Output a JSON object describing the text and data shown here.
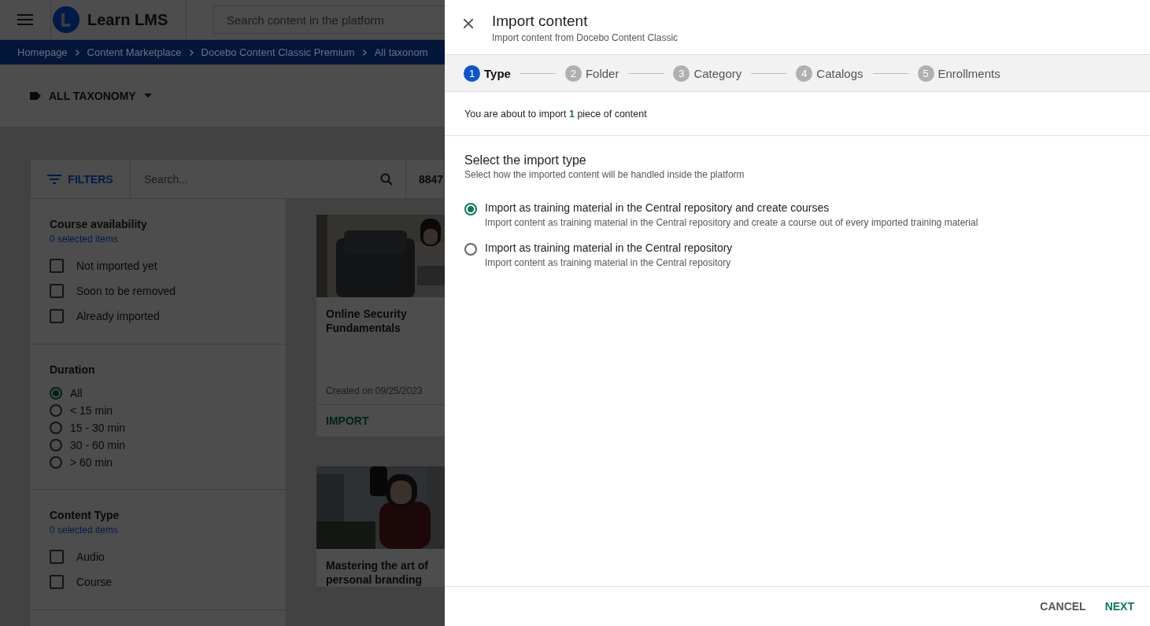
{
  "header": {
    "logo_text": "Learn LMS",
    "search_placeholder": "Search content in the platform"
  },
  "breadcrumbs": [
    "Homepage",
    "Content Marketplace",
    "Docebo Content Classic Premium",
    "All taxonom"
  ],
  "taxonomy_menu": {
    "label": "ALL TAXONOMY"
  },
  "toolbar": {
    "filters_label": "FILTERS",
    "search_placeholder": "Search...",
    "count": "8847"
  },
  "filter_groups": [
    {
      "title": "Course availability",
      "subtitle": "0 selected items",
      "kind": "checkbox",
      "options": [
        {
          "label": "Not imported yet",
          "checked": false
        },
        {
          "label": "Soon to be removed",
          "checked": false
        },
        {
          "label": "Already imported",
          "checked": false
        }
      ]
    },
    {
      "title": "Duration",
      "kind": "radio",
      "options": [
        {
          "label": "All",
          "selected": true
        },
        {
          "label": "< 15 min",
          "selected": false
        },
        {
          "label": "15 - 30 min",
          "selected": false
        },
        {
          "label": "30 - 60 min",
          "selected": false
        },
        {
          "label": "> 60 min",
          "selected": false
        }
      ]
    },
    {
      "title": "Content Type",
      "subtitle": "0 selected items",
      "kind": "checkbox",
      "options": [
        {
          "label": "Audio",
          "checked": false
        },
        {
          "label": "Course",
          "checked": false
        }
      ]
    }
  ],
  "cards": [
    {
      "title": "Online Security Fundamentals",
      "date": "Created on 09/25/2023",
      "action": "IMPORT"
    },
    {
      "title": "Mastering the art of personal branding"
    }
  ],
  "dialog": {
    "title": "Import content",
    "subtitle": "Import content from Docebo Content Classic",
    "steps": [
      {
        "number": "1",
        "label": "Type",
        "selected": true
      },
      {
        "number": "2",
        "label": "Folder",
        "selected": false
      },
      {
        "number": "3",
        "label": "Category",
        "selected": false
      },
      {
        "number": "4",
        "label": "Catalogs",
        "selected": false
      },
      {
        "number": "5",
        "label": "Enrollments",
        "selected": false
      }
    ],
    "summary": "You are about to import **1** piece of content",
    "section_title": "Select the import type",
    "section_subtitle": "Select how the imported content will be handled inside the platform",
    "options": [
      {
        "label": "Import as training material in the Central repository and create courses",
        "description": "Import content as training material in the Central repository and create a course out of every imported training material",
        "selected": true
      },
      {
        "label": "Import as training material in the Central repository",
        "description": "Import content as training material in the Central repository",
        "selected": false
      }
    ],
    "buttons": [
      {
        "label": "CANCEL",
        "kind": "secondary"
      },
      {
        "label": "NEXT",
        "kind": "primary"
      }
    ]
  }
}
